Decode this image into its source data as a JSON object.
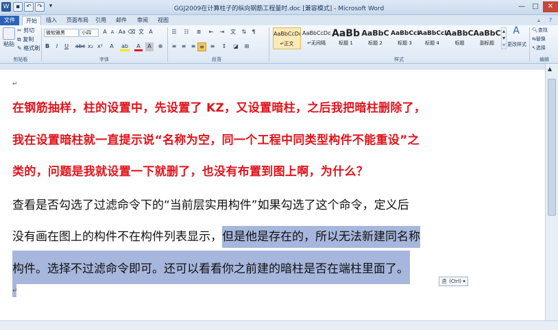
{
  "window": {
    "title": "GGJ2009在计算柱子的纵向钢筋工程量时.doc [兼容模式] - Microsoft Word"
  },
  "tabs": [
    "文件",
    "开始",
    "插入",
    "页面布局",
    "引用",
    "邮件",
    "审阅",
    "视图"
  ],
  "clipboard": {
    "paste": "粘贴",
    "cut": "剪切",
    "copy": "复制",
    "format_painter": "格式刷",
    "label": "剪贴板"
  },
  "font": {
    "name": "微软雅黑",
    "size": "小四",
    "label": "字体"
  },
  "paragraph": {
    "label": "段落"
  },
  "styles": {
    "items": [
      {
        "preview": "AaBbCcDd",
        "name": "↵正文"
      },
      {
        "preview": "AaBbCcDd",
        "name": "↵无间隔"
      },
      {
        "preview": "AaBb",
        "name": "标题 1"
      },
      {
        "preview": "AaBbC",
        "name": "标题 2"
      },
      {
        "preview": "AaBbCcD",
        "name": "标题 3"
      },
      {
        "preview": "AaBbCcD",
        "name": "标题 4"
      },
      {
        "preview": "AaBbC",
        "name": "标题"
      },
      {
        "preview": "AaBbC",
        "name": "副标题"
      }
    ],
    "change_styles": "更改样式",
    "label": "样式"
  },
  "editing": {
    "find": "查找",
    "replace": "替换",
    "select": "选择",
    "label": "编辑"
  },
  "document": {
    "question_lines": [
      "在钢筋抽样，柱的设置中，先设置了 KZ，又设置暗柱，之后我把暗柱删除了，",
      "我在设置暗柱就一直提示说“名称为空，同一个工程中同类型构件不能重设”之",
      "类的，问题是我就设置一下就删了，也没有布置到图上啊，为什么？"
    ],
    "answer_line1": "查看是否勾选了过滤命令下的“当前层实用构件”如果勾选了这个命令，定义后",
    "answer_line2_plain": "没有画在图上的构件不在构件列表显示，",
    "answer_line2_hl": "但是他是存在的，所以无法新建同名称",
    "answer_line3": "构件。选择不过滤命令即可。还可以看看你之前建的暗柱是否在端柱里面了。"
  },
  "paste_options": "(Ctrl)"
}
